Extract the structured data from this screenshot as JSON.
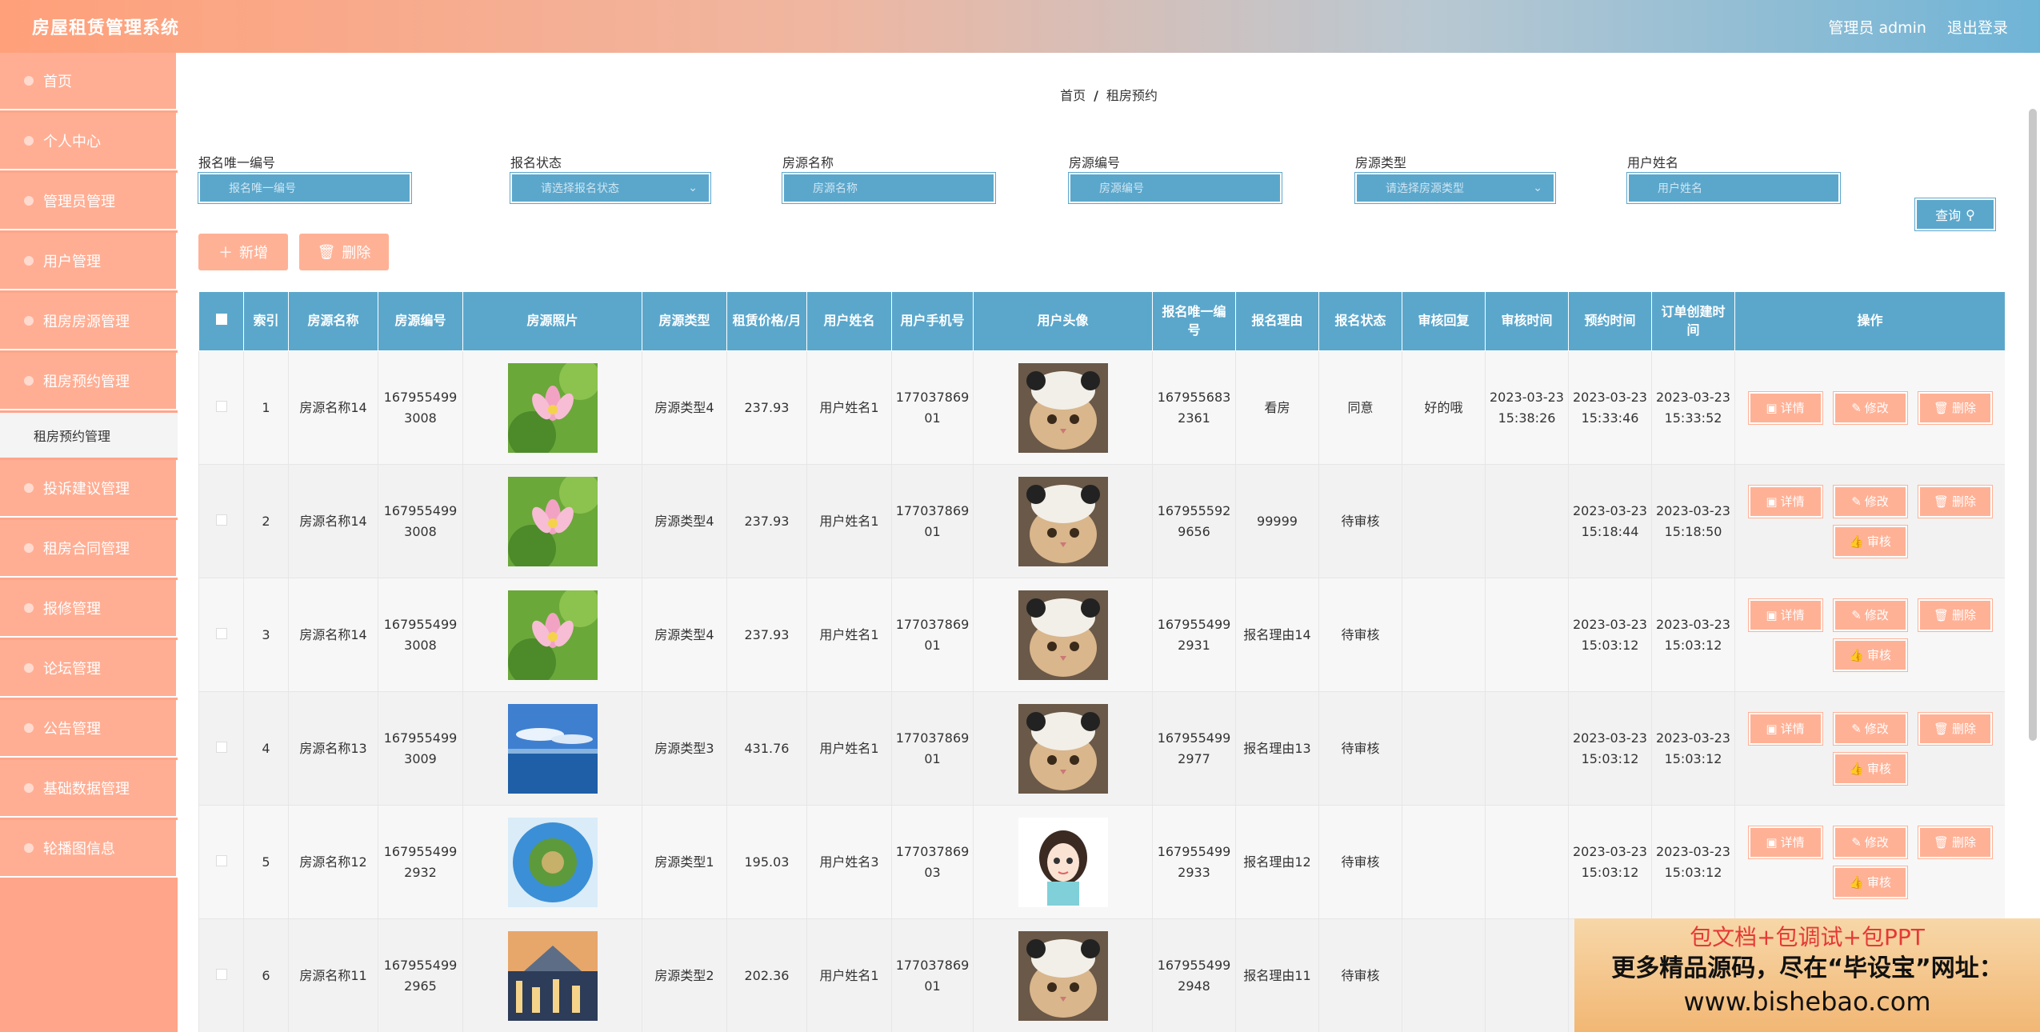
{
  "header": {
    "title": "房屋租赁管理系统",
    "admin_label": "管理员 admin",
    "logout": "退出登录"
  },
  "sidebar": {
    "items": [
      {
        "label": "首页"
      },
      {
        "label": "个人中心"
      },
      {
        "label": "管理员管理"
      },
      {
        "label": "用户管理"
      },
      {
        "label": "租房房源管理"
      },
      {
        "label": "租房预约管理"
      },
      {
        "label": "投诉建议管理"
      },
      {
        "label": "租房合同管理"
      },
      {
        "label": "报修管理"
      },
      {
        "label": "论坛管理"
      },
      {
        "label": "公告管理"
      },
      {
        "label": "基础数据管理"
      },
      {
        "label": "轮播图信息"
      }
    ],
    "sub_item": "租房预约管理"
  },
  "breadcrumb": {
    "home": "首页",
    "sep": "/",
    "current": "租房预约"
  },
  "filters": {
    "f1": {
      "label": "报名唯一编号",
      "placeholder": "报名唯一编号"
    },
    "f2": {
      "label": "报名状态",
      "placeholder": "请选择报名状态"
    },
    "f3": {
      "label": "房源名称",
      "placeholder": "房源名称"
    },
    "f4": {
      "label": "房源编号",
      "placeholder": "房源编号"
    },
    "f5": {
      "label": "房源类型",
      "placeholder": "请选择房源类型"
    },
    "f6": {
      "label": "用户姓名",
      "placeholder": "用户姓名"
    },
    "query": "查询"
  },
  "actions": {
    "add": "新增",
    "delete": "删除"
  },
  "table": {
    "headers": [
      "索引",
      "房源名称",
      "房源编号",
      "房源照片",
      "房源类型",
      "租赁价格/月",
      "用户姓名",
      "用户手机号",
      "用户头像",
      "报名唯一编号",
      "报名理由",
      "报名状态",
      "审核回复",
      "审核时间",
      "预约时间",
      "订单创建时间",
      "操作"
    ],
    "rows": [
      {
        "idx": "1",
        "name": "房源名称14",
        "code": "1679554993008",
        "photo": "lotus",
        "type": "房源类型4",
        "price": "237.93",
        "user": "用户姓名1",
        "phone": "17703786901",
        "avatar": "cat",
        "regno": "1679556832361",
        "reason": "看房",
        "status": "同意",
        "reply": "好的哦",
        "audit_time": "2023-03-23 15:38:26",
        "book_time": "2023-03-23 15:33:46",
        "create_time": "2023-03-23 15:33:52",
        "audit_btn": false
      },
      {
        "idx": "2",
        "name": "房源名称14",
        "code": "1679554993008",
        "photo": "lotus",
        "type": "房源类型4",
        "price": "237.93",
        "user": "用户姓名1",
        "phone": "17703786901",
        "avatar": "cat",
        "regno": "1679555929656",
        "reason": "99999",
        "status": "待审核",
        "reply": "",
        "audit_time": "",
        "book_time": "2023-03-23 15:18:44",
        "create_time": "2023-03-23 15:18:50",
        "audit_btn": true
      },
      {
        "idx": "3",
        "name": "房源名称14",
        "code": "1679554993008",
        "photo": "lotus",
        "type": "房源类型4",
        "price": "237.93",
        "user": "用户姓名1",
        "phone": "17703786901",
        "avatar": "cat",
        "regno": "1679554992931",
        "reason": "报名理由14",
        "status": "待审核",
        "reply": "",
        "audit_time": "",
        "book_time": "2023-03-23 15:03:12",
        "create_time": "2023-03-23 15:03:12",
        "audit_btn": true
      },
      {
        "idx": "4",
        "name": "房源名称13",
        "code": "1679554993009",
        "photo": "sea",
        "type": "房源类型3",
        "price": "431.76",
        "user": "用户姓名1",
        "phone": "17703786901",
        "avatar": "cat",
        "regno": "1679554992977",
        "reason": "报名理由13",
        "status": "待审核",
        "reply": "",
        "audit_time": "",
        "book_time": "2023-03-23 15:03:12",
        "create_time": "2023-03-23 15:03:12",
        "audit_btn": true
      },
      {
        "idx": "5",
        "name": "房源名称12",
        "code": "1679554992932",
        "photo": "planet",
        "type": "房源类型1",
        "price": "195.03",
        "user": "用户姓名3",
        "phone": "17703786903",
        "avatar": "girl",
        "regno": "1679554992933",
        "reason": "报名理由12",
        "status": "待审核",
        "reply": "",
        "audit_time": "",
        "book_time": "2023-03-23 15:03:12",
        "create_time": "2023-03-23 15:03:12",
        "audit_btn": true
      },
      {
        "idx": "6",
        "name": "房源名称11",
        "code": "1679554992965",
        "photo": "city",
        "type": "房源类型2",
        "price": "202.36",
        "user": "用户姓名1",
        "phone": "17703786901",
        "avatar": "cat",
        "regno": "1679554992948",
        "reason": "报名理由11",
        "status": "待审核",
        "reply": "",
        "audit_time": "",
        "book_time": "",
        "create_time": "",
        "audit_btn": false
      }
    ],
    "ops": {
      "detail": "详情",
      "edit": "修改",
      "delete": "删除",
      "audit": "审核"
    }
  },
  "ad": {
    "line1": "包文档+包调试+包PPT",
    "line2": "更多精品源码，尽在“毕设宝”网址：",
    "line3": "www.bishebao.com"
  },
  "colors": {
    "accent_blue": "#5ba7cc",
    "salmon": "#ffb196",
    "sidebar": "#ffa589"
  }
}
